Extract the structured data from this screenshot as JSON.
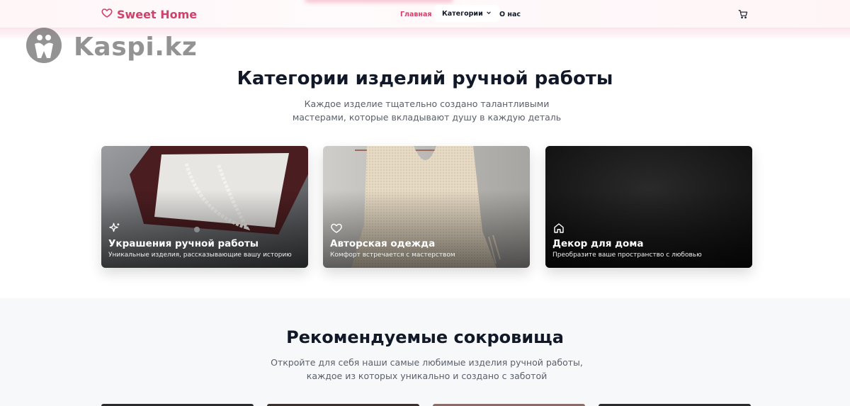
{
  "brand": {
    "name": "Sweet Home",
    "icon": "heart-icon",
    "color": "#d0426b"
  },
  "nav": {
    "home": "Главная",
    "categories": "Категории",
    "about": "О нас",
    "cart_icon": "cart-icon"
  },
  "watermark": {
    "text": "Kaspi.kz"
  },
  "categories_section": {
    "title": "Категории изделий ручной работы",
    "subtitle": "Каждое изделие тщательно создано талантливыми мастерами, которые вкладывают душу в каждую деталь",
    "cards": [
      {
        "title": "Украшения ручной работы",
        "description": "Уникальные изделия, рассказывающие вашу историю",
        "icon": "sparkles-icon"
      },
      {
        "title": "Авторская одежда",
        "description": "Комфорт встречается с мастерством",
        "icon": "heart-icon"
      },
      {
        "title": "Декор для дома",
        "description": "Преобразите ваше пространство с любовью",
        "icon": "home-icon"
      }
    ]
  },
  "featured_section": {
    "title": "Рекомендуемые сокровища",
    "subtitle": "Откройте для себя наши самые любимые изделия ручной работы, каждое из которых уникально и создано с заботой"
  }
}
